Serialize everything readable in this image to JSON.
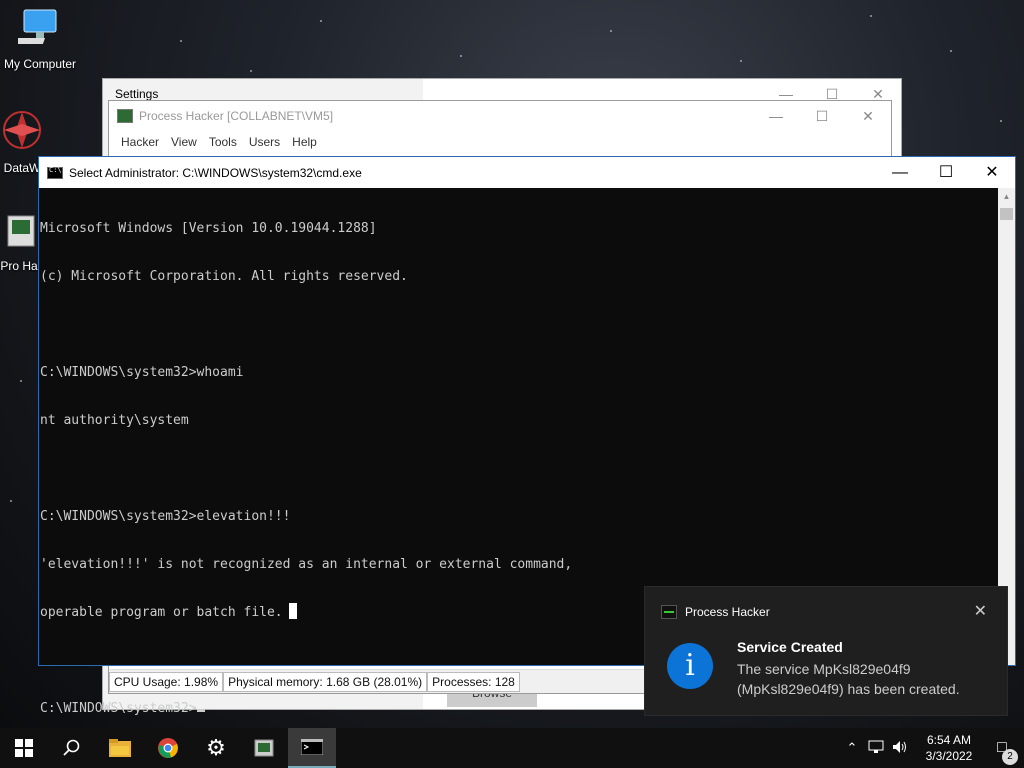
{
  "desktop": {
    "icons": [
      {
        "label": "My Computer"
      },
      {
        "label": "DataW"
      },
      {
        "label": "Pro Hac"
      }
    ]
  },
  "settings_window": {
    "title": "Settings",
    "browse_label": "Browse"
  },
  "process_hacker": {
    "title": "Process Hacker [COLLABNET\\VM5]",
    "menu": [
      "Hacker",
      "View",
      "Tools",
      "Users",
      "Help"
    ],
    "status": {
      "cpu": "CPU Usage: 1.98%",
      "memory": "Physical memory: 1.68 GB (28.01%)",
      "processes": "Processes: 128"
    }
  },
  "cmd": {
    "title": "Select Administrator: C:\\WINDOWS\\system32\\cmd.exe",
    "lines": [
      "Microsoft Windows [Version 10.0.19044.1288]",
      "(c) Microsoft Corporation. All rights reserved.",
      "",
      "C:\\WINDOWS\\system32>whoami",
      "nt authority\\system",
      "",
      "C:\\WINDOWS\\system32>elevation!!!",
      "'elevation!!!' is not recognized as an internal or external command,",
      "operable program or batch file.",
      "",
      "C:\\WINDOWS\\system32>"
    ]
  },
  "toast": {
    "app": "Process Hacker",
    "title": "Service Created",
    "text": "The service MpKsl829e04f9 (MpKsl829e04f9) has been created."
  },
  "taskbar": {
    "time": "6:54 AM",
    "date": "3/3/2022",
    "notification_count": "2"
  },
  "colors": {
    "accent": "#0b74d6",
    "terminal_bg": "#0c0c0c",
    "terminal_fg": "#cccccc"
  }
}
